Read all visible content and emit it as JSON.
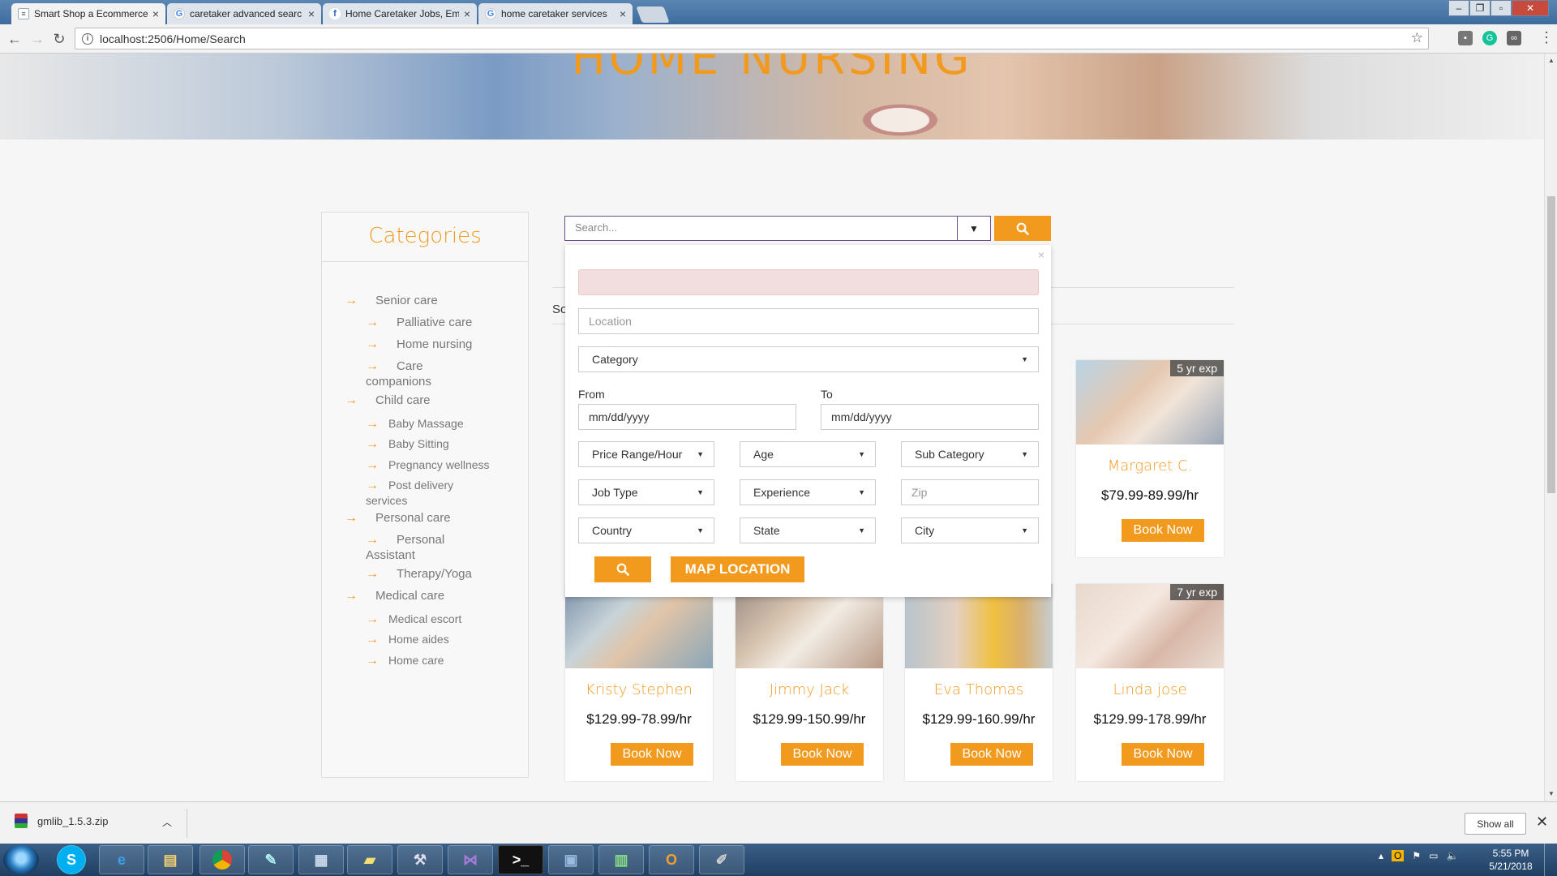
{
  "browser": {
    "tabs": [
      {
        "title": "Smart Shop a Ecommerce",
        "favicon": "doc-icon",
        "active": true
      },
      {
        "title": "caretaker advanced searc",
        "favicon": "google-icon",
        "active": false
      },
      {
        "title": "Home Caretaker Jobs, Em",
        "favicon": "f-icon",
        "active": false
      },
      {
        "title": "home caretaker services",
        "favicon": "google-icon",
        "active": false
      }
    ],
    "url": "localhost:2506/Home/Search",
    "colors": {
      "tabbar": "#3d6c9e",
      "accent": "#f29a1e"
    }
  },
  "hero": {
    "title": "HOME NURSING"
  },
  "categories": {
    "title": "Categories",
    "items": [
      {
        "label": "Senior care",
        "level": 0
      },
      {
        "label": "Palliative care",
        "level": 1
      },
      {
        "label": "Home nursing",
        "level": 1
      },
      {
        "label": "Care companions",
        "level": 1
      },
      {
        "label": "Child care",
        "level": 0
      },
      {
        "label": "Baby Massage",
        "level": 1
      },
      {
        "label": "Baby Sitting",
        "level": 1
      },
      {
        "label": "Pregnancy wellness",
        "level": 1
      },
      {
        "label": "Post delivery services",
        "level": 1
      },
      {
        "label": "Personal care",
        "level": 0
      },
      {
        "label": "Personal Assistant",
        "level": 1
      },
      {
        "label": "Therapy/Yoga",
        "level": 1
      },
      {
        "label": "Medical care",
        "level": 0
      },
      {
        "label": "Medical escort",
        "level": 1
      },
      {
        "label": "Home aides",
        "level": 1
      },
      {
        "label": "Home care",
        "level": 1
      }
    ]
  },
  "search": {
    "placeholder": "Search...",
    "sort_partial": "So"
  },
  "popup": {
    "location_placeholder": "Location",
    "category": "Category",
    "from_label": "From",
    "to_label": "To",
    "date_placeholder": "mm/dd/yyyy",
    "price_range": "Price Range/Hour",
    "age": "Age",
    "sub_category": "Sub Category",
    "job_type": "Job Type",
    "experience": "Experience",
    "zip_placeholder": "Zip",
    "country": "Country",
    "state": "State",
    "city": "City",
    "map_location": "MAP LOCATION",
    "close": "×"
  },
  "caretakers": [
    {
      "name": "Margaret C.",
      "price": "$79.99-89.99/hr",
      "experience": "5 yr exp",
      "button": "Book Now"
    },
    {
      "name": "Kristy Stephen",
      "price": "$129.99-78.99/hr",
      "experience": "",
      "button": "Book Now"
    },
    {
      "name": "Jimmy Jack",
      "price": "$129.99-150.99/hr",
      "experience": "",
      "button": "Book Now"
    },
    {
      "name": "Eva Thomas",
      "price": "$129.99-160.99/hr",
      "experience": "",
      "button": "Book Now"
    },
    {
      "name": "Linda jose",
      "price": "$129.99-178.99/hr",
      "experience": "7 yr exp",
      "button": "Book Now"
    }
  ],
  "download": {
    "filename": "gmlib_1.5.3.zip",
    "show_all": "Show all"
  },
  "taskbar": {
    "time": "5:55 PM",
    "date": "5/21/2018"
  }
}
